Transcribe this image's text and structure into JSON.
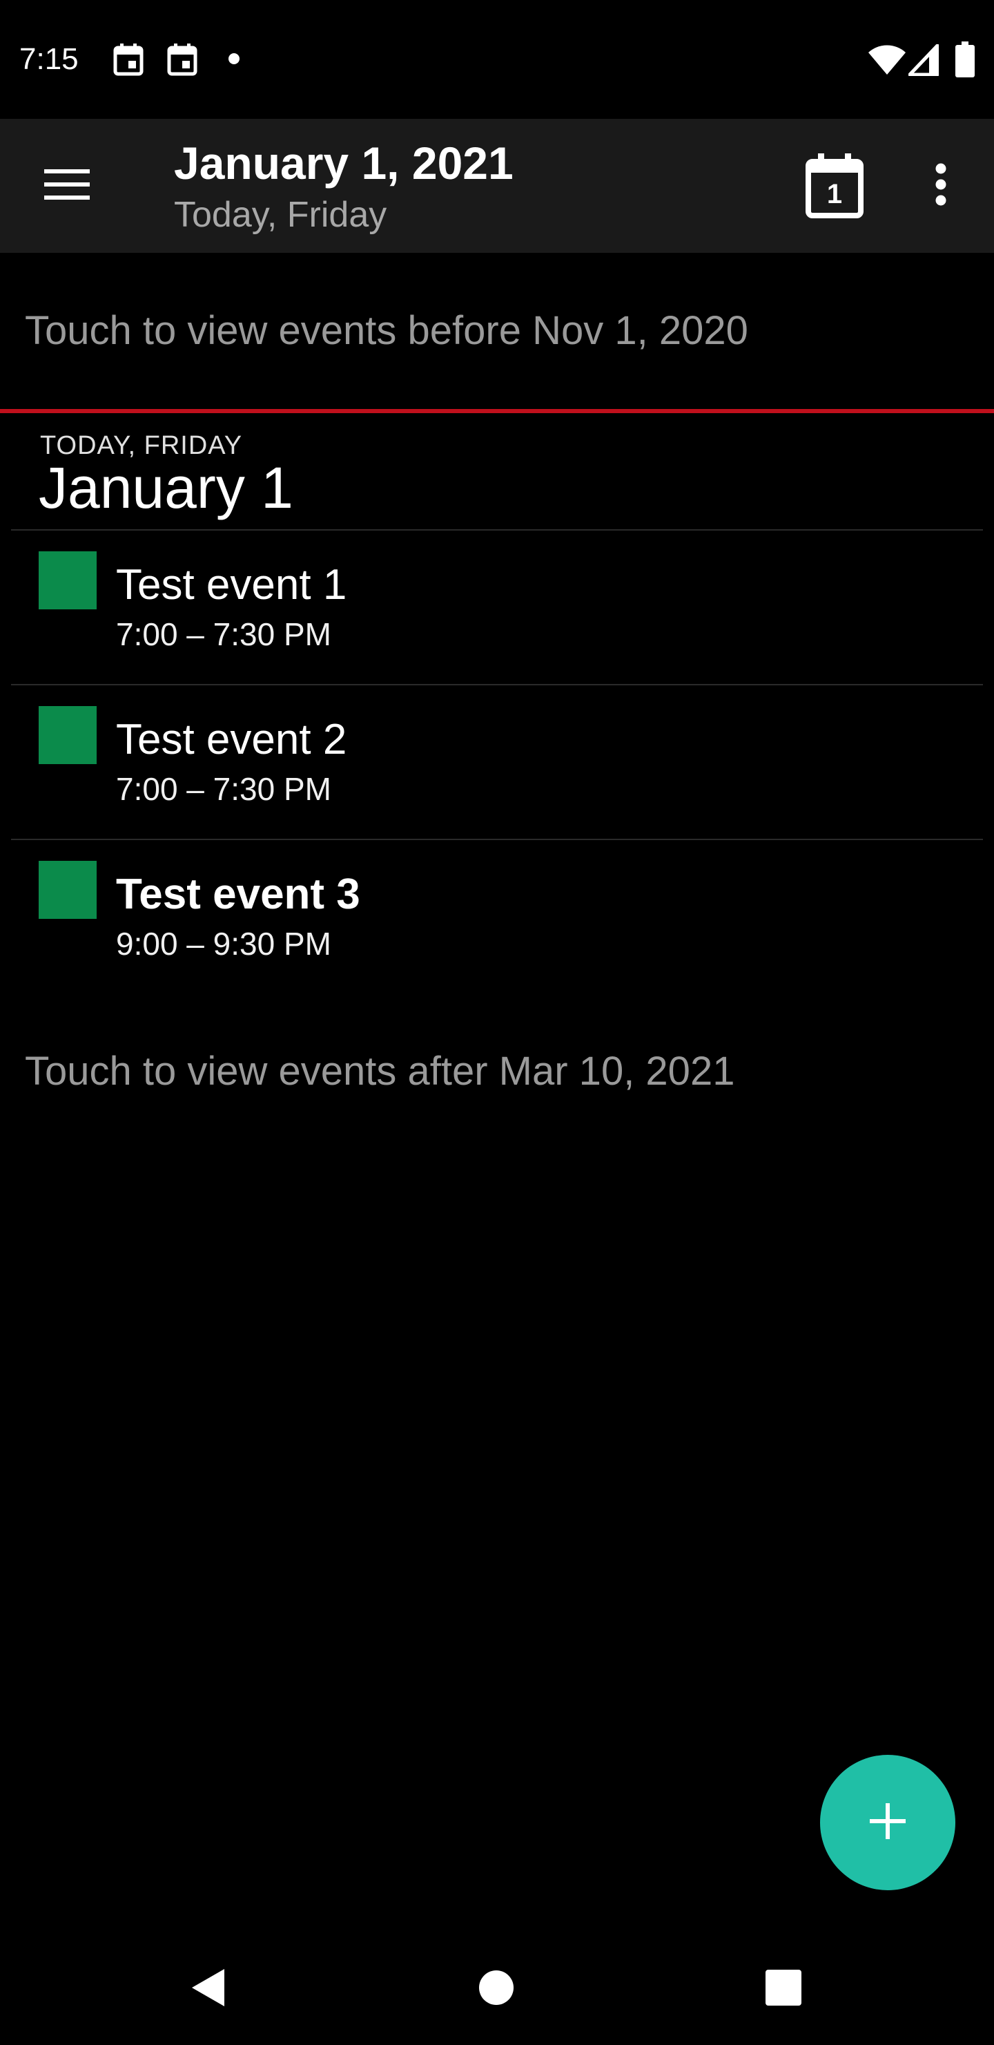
{
  "status_bar": {
    "time": "7:15",
    "icons": [
      "calendar-icon",
      "calendar-icon",
      "dot-icon",
      "wifi-icon",
      "signal-icon",
      "battery-icon"
    ]
  },
  "app_bar": {
    "title": "January 1, 2021",
    "subtitle": "Today, Friday",
    "today_day_number": "1",
    "icons": [
      "menu-icon",
      "calendar-today-icon",
      "more-vert-icon"
    ]
  },
  "list": {
    "load_before_label": "Touch to view events before Nov 1, 2020",
    "load_after_label": "Touch to view events after Mar 10, 2021",
    "day": {
      "header_small": "TODAY, FRIDAY",
      "header_date": "January 1"
    },
    "events": [
      {
        "title": "Test event 1",
        "time": "7:00 – 7:30 PM",
        "color": "#0b8b4b",
        "bold": false
      },
      {
        "title": "Test event 2",
        "time": "7:00 – 7:30 PM",
        "color": "#0b8b4b",
        "bold": false
      },
      {
        "title": "Test event 3",
        "time": "9:00 – 9:30 PM",
        "color": "#0b8b4b",
        "bold": true
      }
    ]
  },
  "fab": {
    "icon": "plus-icon",
    "color": "#20bfa6"
  },
  "nav_bar": {
    "icons": [
      "back-icon",
      "home-icon",
      "recents-icon"
    ]
  },
  "colors": {
    "background": "#000000",
    "app_bar": "#1a1a1a",
    "now_line": "#c0101c",
    "muted_text": "#9a9a9a"
  }
}
